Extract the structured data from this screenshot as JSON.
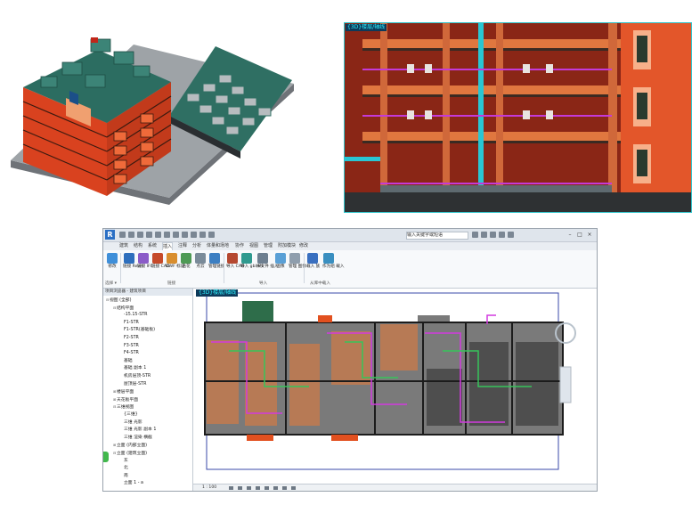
{
  "panel_detail": {
    "view_tag": "{3D}楼层/轴线"
  },
  "revit": {
    "app_logo": "R",
    "title_input": "输入关键字或短语",
    "window_controls": [
      "–",
      "□",
      "×"
    ],
    "menu_tabs": [
      "建筑",
      "结构",
      "系统",
      "插入",
      "注释",
      "分析",
      "体量和场地",
      "协作",
      "视图",
      "管理",
      "附加模块",
      "修改"
    ],
    "active_tab": "插入",
    "ribbon": {
      "items": [
        {
          "label": "修改",
          "icon": "modify-icon",
          "color": "#3f8fd9"
        },
        {
          "label": "链接 Revit",
          "icon": "link-revit-icon",
          "color": "#2e6fbd"
        },
        {
          "label": "链接 IFC",
          "icon": "link-ifc-icon",
          "color": "#8b5cc8"
        },
        {
          "label": "链接 CAD",
          "icon": "link-cad-icon",
          "color": "#c64a2a"
        },
        {
          "label": "DWF 标记",
          "icon": "dwf-markup-icon",
          "color": "#d98e2e"
        },
        {
          "label": "贴花",
          "icon": "decal-icon",
          "color": "#4e9a55"
        },
        {
          "label": "点云",
          "icon": "point-cloud-icon",
          "color": "#7a8b99"
        },
        {
          "label": "管理链接",
          "icon": "manage-links-icon",
          "color": "#3c7fc2"
        },
        {
          "label": "导入 CAD",
          "icon": "import-cad-icon",
          "color": "#b54830"
        },
        {
          "label": "导入 gbXML",
          "icon": "import-gbxml-icon",
          "color": "#2f9a8f"
        },
        {
          "label": "从文件 插入",
          "icon": "insert-from-file-icon",
          "color": "#6e7f90"
        },
        {
          "label": "图像",
          "icon": "image-icon",
          "color": "#5aa0d6"
        },
        {
          "label": "管理 图像",
          "icon": "manage-images-icon",
          "color": "#8f9ead"
        },
        {
          "label": "载入 族",
          "icon": "load-family-icon",
          "color": "#3a70c0"
        },
        {
          "label": "作为组 载入",
          "icon": "load-as-group-icon",
          "color": "#3a8fc0"
        }
      ],
      "groups": [
        "选择 ▾",
        "链接",
        "导入",
        "从库中载入"
      ]
    },
    "browser": {
      "title": "项目浏览器 - 建筑项目",
      "tree": [
        {
          "text": "视图 (全部)",
          "exp": "⊟",
          "indent": 0
        },
        {
          "text": "结构平面",
          "exp": "⊟",
          "indent": 1
        },
        {
          "text": "-15.15-STR",
          "exp": "",
          "indent": 2
        },
        {
          "text": "F1-STR",
          "exp": "",
          "indent": 2
        },
        {
          "text": "F1-STR(基础板)",
          "exp": "",
          "indent": 2
        },
        {
          "text": "F2-STR",
          "exp": "",
          "indent": 2
        },
        {
          "text": "F3-STR",
          "exp": "",
          "indent": 2
        },
        {
          "text": "F4-STR",
          "exp": "",
          "indent": 2
        },
        {
          "text": "基础",
          "exp": "",
          "indent": 2
        },
        {
          "text": "基础 副本 1",
          "exp": "",
          "indent": 2
        },
        {
          "text": "机房层顶-STR",
          "exp": "",
          "indent": 2
        },
        {
          "text": "屋顶层-STR",
          "exp": "",
          "indent": 2
        },
        {
          "text": "楼层平面",
          "exp": "⊞",
          "indent": 1
        },
        {
          "text": "天花板平面",
          "exp": "⊞",
          "indent": 1
        },
        {
          "text": "三维视图",
          "exp": "⊟",
          "indent": 1
        },
        {
          "text": "{三维}",
          "exp": "",
          "indent": 2
        },
        {
          "text": "三维 光影",
          "exp": "",
          "indent": 2
        },
        {
          "text": "三维 光影 副本 1",
          "exp": "",
          "indent": 2
        },
        {
          "text": "三维 渲染 横截",
          "exp": "",
          "indent": 2
        },
        {
          "text": "立面 (内部立面)",
          "exp": "⊞",
          "indent": 1
        },
        {
          "text": "立面 (建筑立面)",
          "exp": "⊟",
          "indent": 1
        },
        {
          "text": "东",
          "exp": "",
          "indent": 2
        },
        {
          "text": "北",
          "exp": "",
          "indent": 2
        },
        {
          "text": "南",
          "exp": "",
          "indent": 2
        },
        {
          "text": "立面 1 - a",
          "exp": "",
          "indent": 2
        }
      ]
    },
    "canvas": {
      "view_tag": "{3D}楼层/轴线"
    },
    "status": {
      "scale": "1 : 100"
    }
  }
}
